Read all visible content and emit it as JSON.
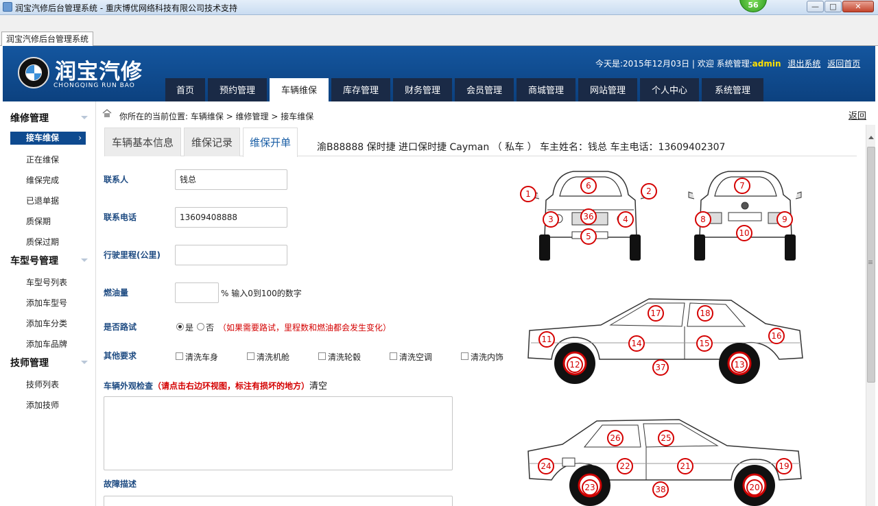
{
  "window": {
    "title": "润宝汽修后台管理系统 - 重庆博优网络科技有限公司技术支持",
    "counter": "56",
    "min_label": "—",
    "max_label": "□",
    "close_label": "✕"
  },
  "doc_tab": "润宝汽修后台管理系统",
  "header": {
    "brand": "润宝汽修",
    "brand_sub": "CHONGQING RUN BAO",
    "date_text": "今天是:2015年12月03日 | 欢迎 系统管理:",
    "admin": "admin",
    "logout": "退出系统",
    "home": "返回首页"
  },
  "nav": [
    "首页",
    "预约管理",
    "车辆维保",
    "库存管理",
    "财务管理",
    "会员管理",
    "商城管理",
    "网站管理",
    "个人中心",
    "系统管理"
  ],
  "sidebar": {
    "groups": [
      {
        "title": "维修管理",
        "items": [
          "接车维保",
          "正在维保",
          "维保完成",
          "已退单据",
          "质保期",
          "质保过期"
        ]
      },
      {
        "title": "车型号管理",
        "items": [
          "车型号列表",
          "添加车型号",
          "添加车分类",
          "添加车品牌"
        ]
      },
      {
        "title": "技师管理",
        "items": [
          "技师列表",
          "添加技师"
        ]
      }
    ],
    "active_chevron": "›"
  },
  "breadcrumb": {
    "text": "你所在的当前位置:  车辆维保  >  维修管理  >  接车维保",
    "back": "返回"
  },
  "content": {
    "tabs": [
      "车辆基本信息",
      "维保记录",
      "维保开单"
    ],
    "vehicle_info": "渝B88888 保时捷 进口保时捷 Cayman （ 私车 ） 车主姓名：钱总 车主电话：13609402307",
    "form": {
      "contact_label": "联系人",
      "contact_value": "钱总",
      "phone_label": "联系电话",
      "phone_value": "13609408888",
      "mileage_label": "行驶里程(公里)",
      "mileage_value": "",
      "fuel_label": "燃油量",
      "fuel_value": "",
      "fuel_hint": "% 输入0到100的数字",
      "road_test_label": "是否路试",
      "yes": "是",
      "no": "否",
      "road_test_hint": "（如果需要路试，里程数和燃油都会发生变化）",
      "other_label": "其他要求",
      "other_options": [
        "清洗车身",
        "清洗机舱",
        "清洗轮毂",
        "清洗空调",
        "清洗内饰"
      ],
      "exterior_label": "车辆外观检查",
      "exterior_hint": "（请点击右边环视图，标注有损坏的地方）",
      "exterior_clear": "清空",
      "fault_label": "故障描述"
    },
    "car_markers": {
      "front": [
        "1",
        "6",
        "2",
        "3",
        "36",
        "4",
        "5"
      ],
      "rear": [
        "7",
        "8",
        "9",
        "10"
      ],
      "right": [
        "17",
        "18",
        "11",
        "14",
        "15",
        "16",
        "12",
        "37",
        "13"
      ],
      "left": [
        "26",
        "25",
        "24",
        "22",
        "21",
        "19",
        "23",
        "38",
        "20"
      ]
    }
  }
}
